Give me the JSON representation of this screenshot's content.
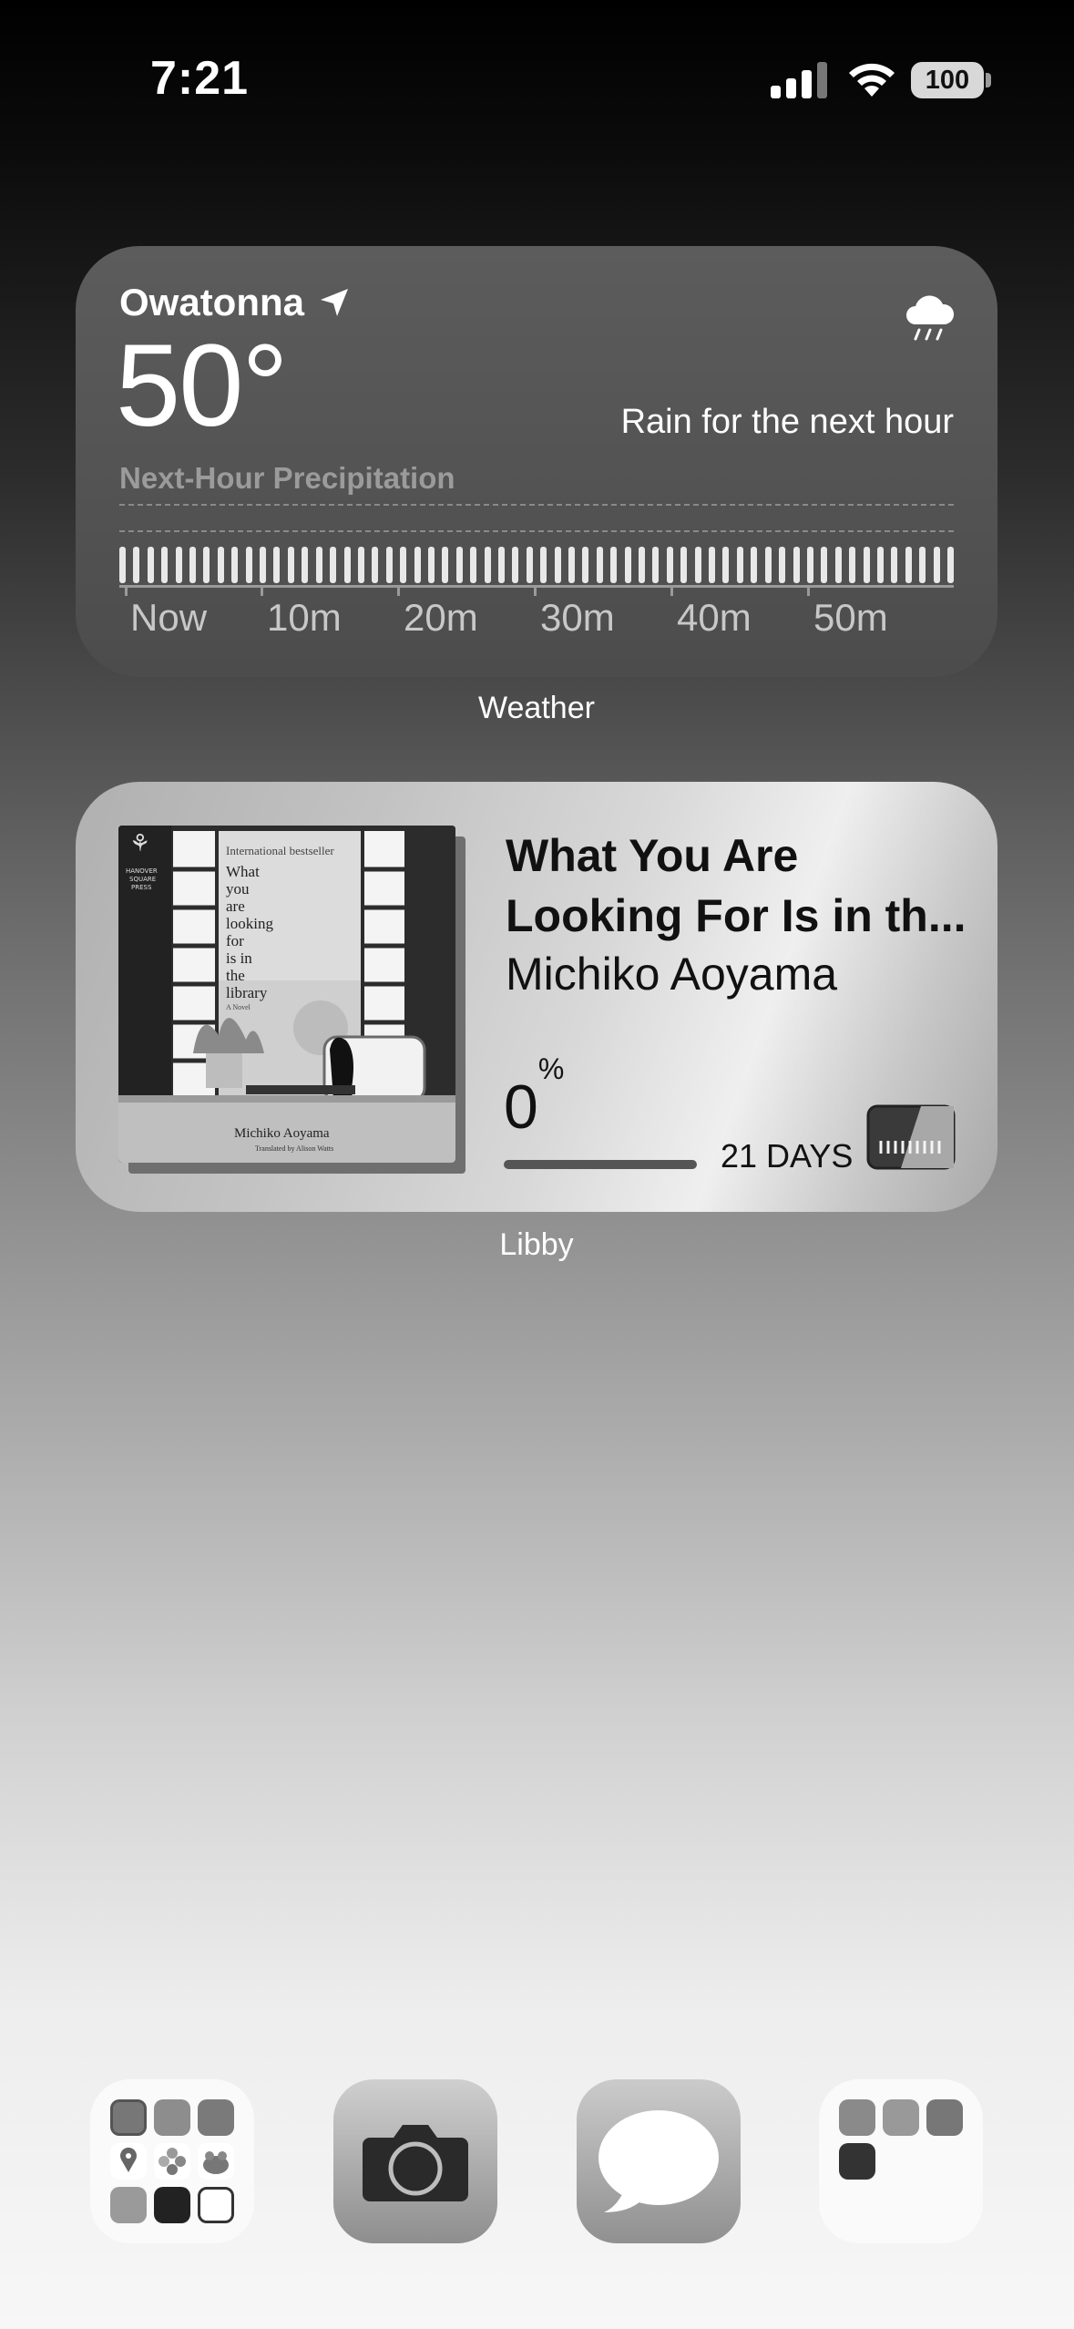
{
  "status_bar": {
    "time": "7:21",
    "battery": "100"
  },
  "weather_widget": {
    "city": "Owatonna",
    "temperature": "50°",
    "forecast": "Rain for the next hour",
    "precip_title": "Next-Hour Precipitation",
    "time_labels": [
      "Now",
      "10m",
      "20m",
      "30m",
      "40m",
      "50m"
    ],
    "icon": "cloud-rain-icon",
    "label": "Weather"
  },
  "libby_widget": {
    "title_line1": "What You Are",
    "title_line2": "Looking For Is in th...",
    "author": "Michiko Aoyama",
    "progress_value": "0",
    "progress_unit": "%",
    "progress_fraction": 0,
    "days_left": "21 DAYS",
    "label": "Libby",
    "cover": {
      "banner": "International bestseller",
      "title_lines": [
        "What",
        "you",
        "are",
        "looking",
        "for",
        "is in",
        "the",
        "library"
      ],
      "subtitle": "A Novel",
      "author": "Michiko Aoyama",
      "translator": "Translated by Alison Watts",
      "publisher_lines": [
        "HANOVER",
        "SQUARE",
        "PRESS"
      ]
    }
  },
  "dock": {
    "apps": [
      "app-folder-1",
      "camera",
      "messages",
      "app-folder-2"
    ]
  }
}
